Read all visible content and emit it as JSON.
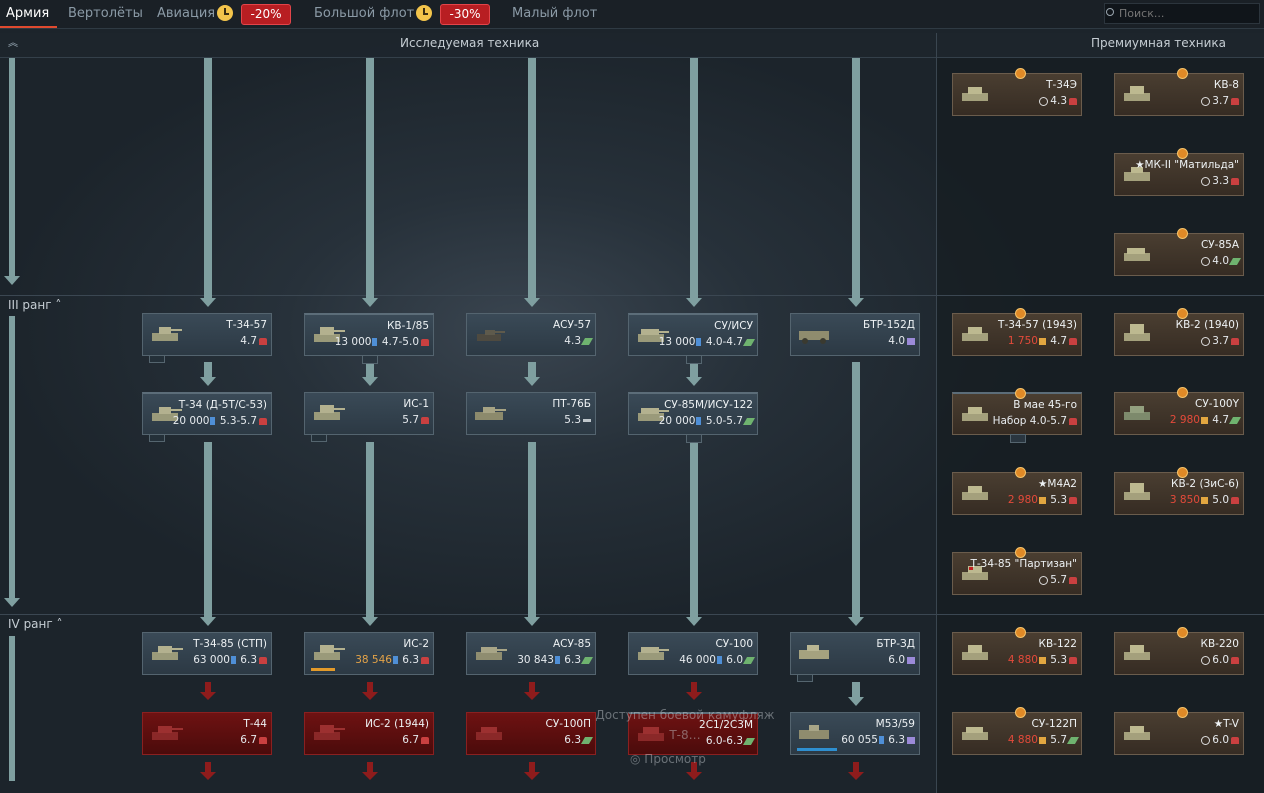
{
  "tabs": [
    {
      "label": "Армия"
    },
    {
      "label": "Вертолёты"
    },
    {
      "label": "Авиация",
      "discount": "-20%"
    },
    {
      "label": "Большой флот",
      "discount": "-30%"
    },
    {
      "label": "Малый флот"
    }
  ],
  "search": {
    "placeholder": "Поиск..."
  },
  "headers": {
    "research": "Исследуемая техника",
    "premium": "Премиумная техника"
  },
  "ranks": {
    "r3": "III ранг",
    "r4": "IV ранг"
  },
  "overlay": {
    "line1": "Доступен боевой камуфляж",
    "line2": "Т-8…",
    "button": "Просмотр"
  },
  "vehicles": {
    "t34_57": {
      "name": "Т-34-57",
      "br": "4.7"
    },
    "kv1_85": {
      "name": "КВ-1/85",
      "rp": "13 000",
      "br": "4.7-5.0"
    },
    "asu57": {
      "name": "АСУ-57",
      "br": "4.3"
    },
    "su_isu": {
      "name": "СУ/ИСУ",
      "rp": "13 000",
      "br": "4.0-4.7"
    },
    "btr152d": {
      "name": "БТР-152Д",
      "br": "4.0"
    },
    "t34_d5t": {
      "name": "Т-34 (Д-5Т/С-53)",
      "rp": "20 000",
      "br": "5.3-5.7"
    },
    "is1": {
      "name": "ИС-1",
      "br": "5.7"
    },
    "pt76b": {
      "name": "ПТ-76Б",
      "br": "5.3"
    },
    "su85m": {
      "name": "СУ-85М/ИСУ-122",
      "rp": "20 000",
      "br": "5.0-5.7"
    },
    "t34_85": {
      "name": "Т-34-85 (СТП)",
      "rp": "63 000",
      "br": "6.3"
    },
    "is2": {
      "name": "ИС-2",
      "rp": "38 546",
      "br": "6.3"
    },
    "asu85": {
      "name": "АСУ-85",
      "rp": "30 843",
      "br": "6.3"
    },
    "su100": {
      "name": "СУ-100",
      "rp": "46 000",
      "br": "6.0"
    },
    "btr3d": {
      "name": "БТР-ЗД",
      "br": "6.0"
    },
    "t44": {
      "name": "Т-44",
      "br": "6.7"
    },
    "is2_44": {
      "name": "ИС-2 (1944)",
      "br": "6.7"
    },
    "su100p": {
      "name": "СУ-100П",
      "br": "6.3"
    },
    "2s1": {
      "name": "2С1/2С3М",
      "br": "6.0-6.3"
    },
    "m53": {
      "name": "M53/59",
      "rp": "60 055",
      "br": "6.3"
    }
  },
  "premium": {
    "t34e": {
      "name": "Т-34Э",
      "br": "4.3"
    },
    "kv8": {
      "name": "КВ-8",
      "br": "3.7"
    },
    "matilda": {
      "name": "★МК-II \"Матильда\"",
      "br": "3.3"
    },
    "su85a": {
      "name": "СУ-85А",
      "br": "4.0"
    },
    "t34_57_43": {
      "name": "Т-34-57 (1943)",
      "cost": "1 750",
      "br": "4.7"
    },
    "kv2_40": {
      "name": "КВ-2 (1940)",
      "br": "3.7"
    },
    "may45": {
      "name": "В мае 45-го",
      "br": "Набор 4.0-5.7"
    },
    "su100y": {
      "name": "СУ-100Y",
      "cost": "2 980",
      "br": "4.7"
    },
    "m4a2": {
      "name": "★M4A2",
      "cost": "2 980",
      "br": "5.3"
    },
    "kv2_zis": {
      "name": "КВ-2 (ЗиС-6)",
      "cost": "3 850",
      "br": "5.0"
    },
    "partizan": {
      "name": "Т-34-85 \"Партизан\"",
      "br": "5.7"
    },
    "kv122": {
      "name": "КВ-122",
      "cost": "4 880",
      "br": "5.3"
    },
    "kv220": {
      "name": "КВ-220",
      "br": "6.0"
    },
    "su122p": {
      "name": "СУ-122П",
      "cost": "4 880",
      "br": "5.7"
    },
    "tv": {
      "name": "★T-V",
      "br": "6.0"
    }
  }
}
